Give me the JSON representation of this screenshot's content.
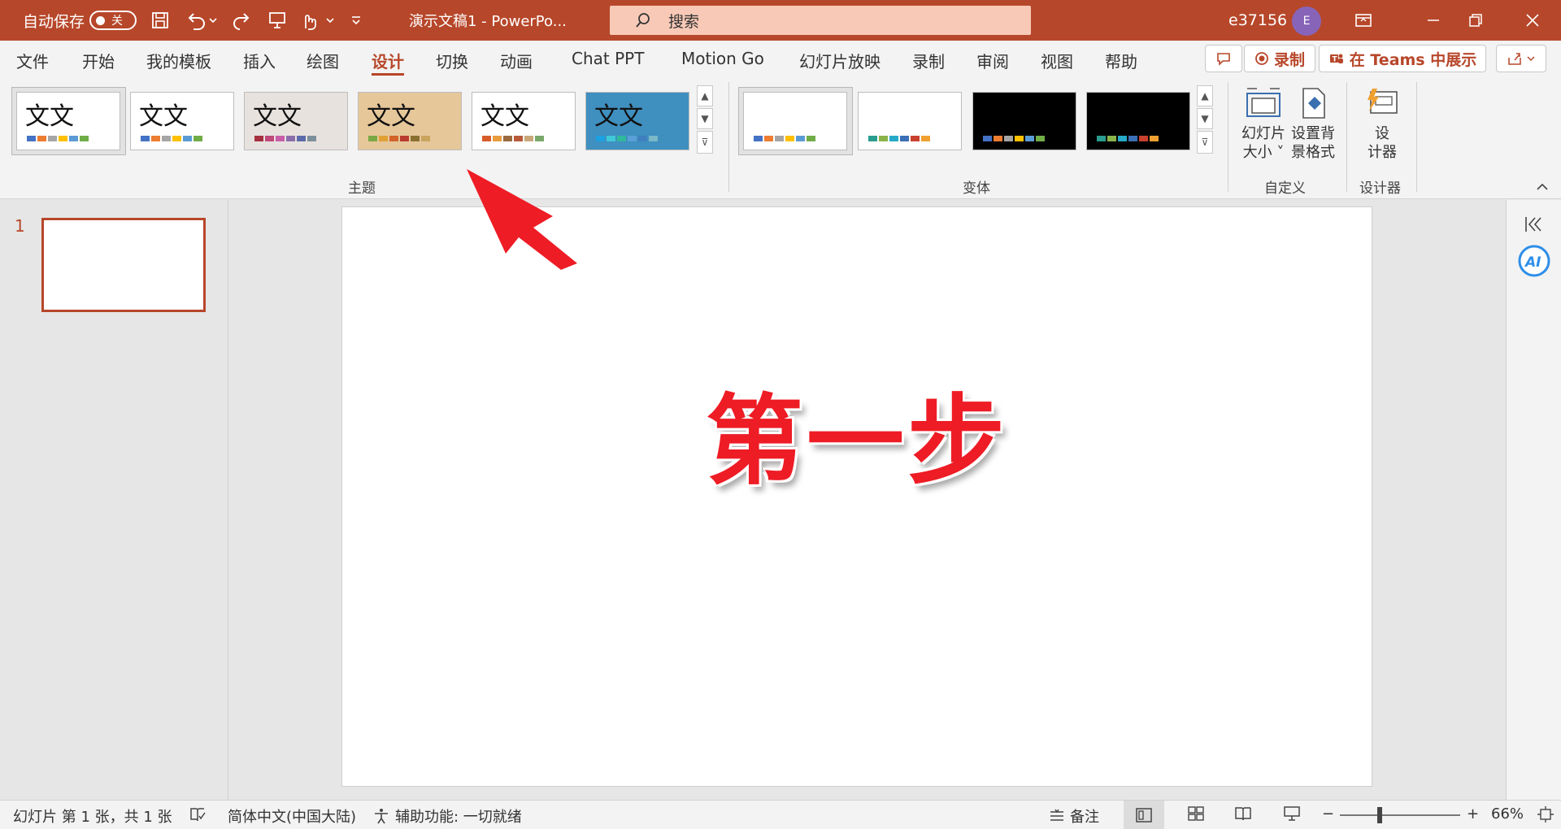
{
  "titlebar": {
    "autosave_label": "自动保存",
    "autosave_state": "关",
    "doc_title": "演示文稿1  -  PowerPo...",
    "search_placeholder": "搜索",
    "user_name": "e37156",
    "avatar_initial": "E"
  },
  "menu": {
    "tabs": [
      "文件",
      "开始",
      "我的模板",
      "插入",
      "绘图",
      "设计",
      "切换",
      "动画",
      "Chat PPT",
      "Motion Go",
      "幻灯片放映",
      "录制",
      "审阅",
      "视图",
      "帮助"
    ],
    "active_tab": "设计",
    "record_label": "录制",
    "teams_label": "在 Teams 中展示"
  },
  "ribbon": {
    "themes_group": "主题",
    "variants_group": "变体",
    "customize_group": "自定义",
    "designer_group": "设计器",
    "theme_sample_text": "文文",
    "slide_size_label": [
      "幻灯片",
      "大小"
    ],
    "bg_format_label": [
      "设置背",
      "景格式"
    ],
    "designer_label": [
      "设",
      "计器"
    ],
    "themes": [
      {
        "bg": "#ffffff",
        "colors": [
          "#4472c4",
          "#ed7d31",
          "#a5a5a5",
          "#ffc000",
          "#5b9bd5",
          "#70ad47"
        ]
      },
      {
        "bg": "#ffffff",
        "colors": [
          "#4472c4",
          "#ed7d31",
          "#a5a5a5",
          "#ffc000",
          "#5b9bd5",
          "#70ad47"
        ]
      },
      {
        "bg": "#e8e2df",
        "colors": [
          "#a5303f",
          "#c0487a",
          "#c95ea8",
          "#8b6dab",
          "#5b6aa8",
          "#7d8f9b"
        ]
      },
      {
        "bg": "#e6c79a",
        "colors": [
          "#7aa843",
          "#e0a033",
          "#d2632b",
          "#b93a2e",
          "#8a7030",
          "#c9a45e"
        ]
      },
      {
        "bg": "#ffffff",
        "colors": [
          "#d85c2a",
          "#e89c3e",
          "#9b6a3f",
          "#b85a3a",
          "#c8a87a",
          "#7aa86a"
        ]
      },
      {
        "bg": "#3f8fbf",
        "colors": [
          "#1ba1e2",
          "#3fc8d8",
          "#2fb99a",
          "#5a9fd8",
          "#3f7fbf",
          "#7ab8c8"
        ]
      }
    ],
    "variants": [
      {
        "bg": "#ffffff",
        "colors": [
          "#4472c4",
          "#ed7d31",
          "#a5a5a5",
          "#ffc000",
          "#5b9bd5",
          "#70ad47"
        ]
      },
      {
        "bg": "#ffffff",
        "colors": [
          "#2a9d8f",
          "#8ab44a",
          "#27a9c8",
          "#3b6fb6",
          "#c8402e",
          "#f0a030"
        ]
      },
      {
        "bg": "#000000",
        "colors": [
          "#4472c4",
          "#ed7d31",
          "#a5a5a5",
          "#ffc000",
          "#5b9bd5",
          "#70ad47"
        ]
      },
      {
        "bg": "#000000",
        "colors": [
          "#2a9d8f",
          "#8ab44a",
          "#27a9c8",
          "#3b6fb6",
          "#c8402e",
          "#f0a030"
        ]
      }
    ]
  },
  "slides": {
    "number": "1"
  },
  "slide": {
    "text": "第一步"
  },
  "statusbar": {
    "slide_info": "幻灯片 第 1 张，共 1 张",
    "language": "简体中文(中国大陆)",
    "accessibility": "辅助功能: 一切就绪",
    "notes": "备注",
    "zoom": "66%"
  }
}
